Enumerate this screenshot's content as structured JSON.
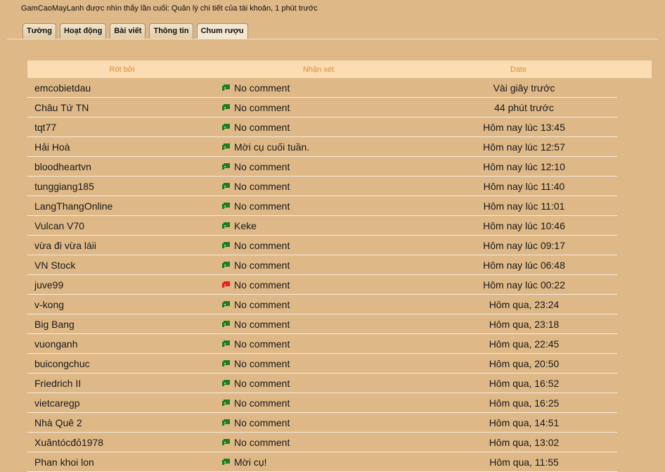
{
  "header": {
    "last_seen": "GamCaoMayLanh được nhìn thấy lần cuối: Quản lý chi tiết của tài khoản, 1 phút trước"
  },
  "tabs": [
    {
      "label": "Tường"
    },
    {
      "label": "Hoạt động"
    },
    {
      "label": "Bài viết"
    },
    {
      "label": "Thông tin"
    },
    {
      "label": "Chum rượu"
    }
  ],
  "table": {
    "headers": {
      "poured_by": "Rót bởi",
      "comment": "Nhận xét",
      "date": "Date"
    },
    "colors": {
      "positive": "#1e7d1e",
      "negative": "#e8201a"
    },
    "rows": [
      {
        "user": "emcobietdau",
        "comment": "No comment",
        "date": "Vài giây trước",
        "type": "positive"
      },
      {
        "user": "Châu Tứ TN",
        "comment": "No comment",
        "date": "44 phút trước",
        "type": "positive"
      },
      {
        "user": "tqt77",
        "comment": "No comment",
        "date": "Hôm nay lúc 13:45",
        "type": "positive"
      },
      {
        "user": "Hải Hoà",
        "comment": "Mời cụ cuối tuần.",
        "date": "Hôm nay lúc 12:57",
        "type": "positive"
      },
      {
        "user": "bloodheartvn",
        "comment": "No comment",
        "date": "Hôm nay lúc 12:10",
        "type": "positive"
      },
      {
        "user": "tunggiang185",
        "comment": "No comment",
        "date": "Hôm nay lúc 11:40",
        "type": "positive"
      },
      {
        "user": "LangThangOnline",
        "comment": "No comment",
        "date": "Hôm nay lúc 11:01",
        "type": "positive"
      },
      {
        "user": "Vulcan V70",
        "comment": "Keke",
        "date": "Hôm nay lúc 10:46",
        "type": "positive"
      },
      {
        "user": "vừa đi vừa láii",
        "comment": "No comment",
        "date": "Hôm nay lúc 09:17",
        "type": "positive"
      },
      {
        "user": "VN Stock",
        "comment": "No comment",
        "date": "Hôm nay lúc 06:48",
        "type": "positive"
      },
      {
        "user": "juve99",
        "comment": "No comment",
        "date": "Hôm nay lúc 00:22",
        "type": "negative"
      },
      {
        "user": "v-kong",
        "comment": "No comment",
        "date": "Hôm qua, 23:24",
        "type": "positive"
      },
      {
        "user": "Big Bang",
        "comment": "No comment",
        "date": "Hôm qua, 23:18",
        "type": "positive"
      },
      {
        "user": "vuonganh",
        "comment": "No comment",
        "date": "Hôm qua, 22:45",
        "type": "positive"
      },
      {
        "user": "buicongchuc",
        "comment": "No comment",
        "date": "Hôm qua, 20:50",
        "type": "positive"
      },
      {
        "user": "Friedrich II",
        "comment": "No comment",
        "date": "Hôm qua, 16:52",
        "type": "positive"
      },
      {
        "user": "vietcaregp",
        "comment": "No comment",
        "date": "Hôm qua, 16:25",
        "type": "positive"
      },
      {
        "user": "Nhà Quê 2",
        "comment": "No comment",
        "date": "Hôm qua, 14:51",
        "type": "positive"
      },
      {
        "user": "Xuântócđỏ1978",
        "comment": "No comment",
        "date": "Hôm qua, 13:02",
        "type": "positive"
      },
      {
        "user": "Phan khoi lon",
        "comment": "Mời cụ!",
        "date": "Hôm qua, 11:55",
        "type": "positive"
      }
    ]
  }
}
